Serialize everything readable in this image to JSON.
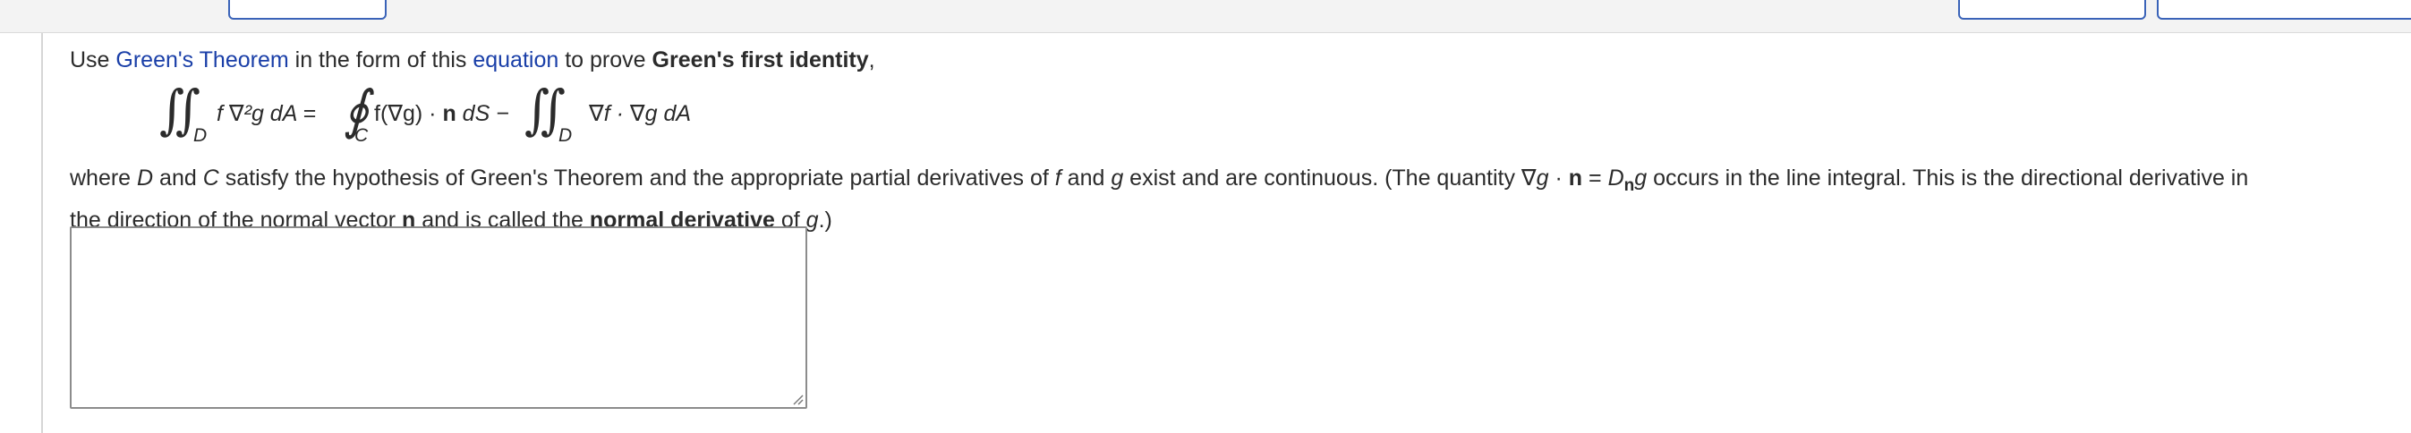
{
  "intro": {
    "use": "Use ",
    "link_greens_theorem": "Green's Theorem",
    "in_form": " in the form of this ",
    "link_equation": "equation",
    "to_prove": " to prove ",
    "identity_name": "Green's first identity",
    "comma": ","
  },
  "formula": {
    "int_symbol": "∬",
    "line_int_symbol": "∮",
    "lhs_integrand": "f ∇²g dA =",
    "sub_D": "D",
    "sub_C": "C",
    "mid_term_a": "f(∇g) · ",
    "mid_term_n": "n",
    "mid_term_b": " dS −",
    "rhs_integrand": "∇f · ∇g dA"
  },
  "para": {
    "line1_a": "where ",
    "D": "D",
    "and": " and ",
    "C": "C",
    "line1_b": " satisfy the hypothesis of Green's Theorem and the appropriate partial derivatives of ",
    "f": "f",
    "and2": " and ",
    "g": "g",
    "line1_c": " exist and are continuous. (The quantity  ∇",
    "g2": "g",
    "dot": " · ",
    "n": "n",
    "eq": " = ",
    "Dn_D": "D",
    "Dn_sub": "n",
    "Dn_g": "g",
    "line1_d": "  occurs in the line integral. This is the directional derivative in",
    "line2_a": "the direction of the normal vector ",
    "n2": "n",
    "line2_b": " and is called the ",
    "normal_derivative": "normal derivative",
    "line2_c": " of ",
    "g3": "g",
    "line2_d": ".)"
  },
  "answer": {
    "value": "",
    "placeholder": ""
  },
  "colors": {
    "link": "#1a3fa8",
    "text": "#2b2b2b",
    "button_border": "#3a63b8"
  }
}
